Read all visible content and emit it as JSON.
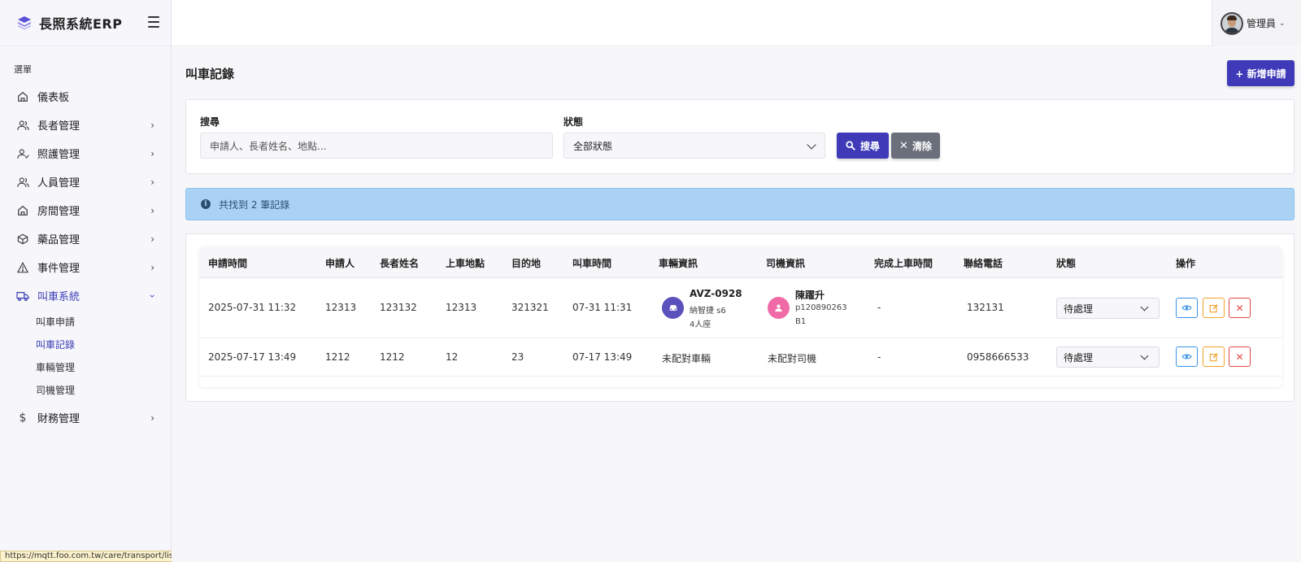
{
  "brand": {
    "name": "長照系統ERP"
  },
  "sidebar": {
    "heading": "選單",
    "items": [
      {
        "label": "儀表板",
        "icon": "home-icon"
      },
      {
        "label": "長者管理",
        "icon": "users-icon"
      },
      {
        "label": "照護管理",
        "icon": "user-check-icon"
      },
      {
        "label": "人員管理",
        "icon": "users-icon"
      },
      {
        "label": "房間管理",
        "icon": "home-icon"
      },
      {
        "label": "藥品管理",
        "icon": "box-icon"
      },
      {
        "label": "事件管理",
        "icon": "warning-icon"
      },
      {
        "label": "叫車系統",
        "icon": "truck-icon"
      },
      {
        "label": "財務管理",
        "icon": "dollar-icon"
      }
    ],
    "subitems": [
      "叫車申請",
      "叫車記錄",
      "車輛管理",
      "司機管理"
    ],
    "active_subitem": "叫車記錄"
  },
  "user": {
    "name": "管理員"
  },
  "status_url": "https://mqtt.foo.com.tw/care/transport/list.php",
  "page": {
    "title": "叫車記錄",
    "new_button": "+ 新增申請"
  },
  "search": {
    "keyword_label": "搜尋",
    "keyword_placeholder": "申請人、長者姓名、地點...",
    "status_label": "狀態",
    "status_value": "全部狀態",
    "search_button": "搜尋",
    "clear_button": "清除"
  },
  "alert": {
    "text": "共找到 2 筆記錄"
  },
  "table": {
    "headers": [
      "申請時間",
      "申請人",
      "長者姓名",
      "上車地點",
      "目的地",
      "叫車時間",
      "車輛資訊",
      "司機資訊",
      "完成上車時間",
      "聯絡電話",
      "狀態",
      "操作"
    ],
    "rows": [
      {
        "apply_time": "2025-07-31 11:32",
        "applicant": "12313",
        "elder": "123132",
        "pickup": "12313",
        "destination": "321321",
        "call_time": "07-31 11:31",
        "vehicle_plate": "AVZ-0928",
        "vehicle_model": "納智捷 s6",
        "vehicle_seats": "4人座",
        "driver_name": "陳躍升",
        "driver_id": "p120890263",
        "driver_license": "B1",
        "done_time": "-",
        "phone": "132131",
        "status": "待處理"
      },
      {
        "apply_time": "2025-07-17 13:49",
        "applicant": "1212",
        "elder": "1212",
        "pickup": "12",
        "destination": "23",
        "call_time": "07-17 13:49",
        "vehicle_text": "未配對車輛",
        "driver_text": "未配對司機",
        "done_time": "-",
        "phone": "0958666533",
        "status": "待處理"
      }
    ]
  },
  "colors": {
    "accent": "#3e3ab8",
    "alert_bg": "#a9d2f5",
    "sidebar_bg": "#f6f6fb"
  }
}
